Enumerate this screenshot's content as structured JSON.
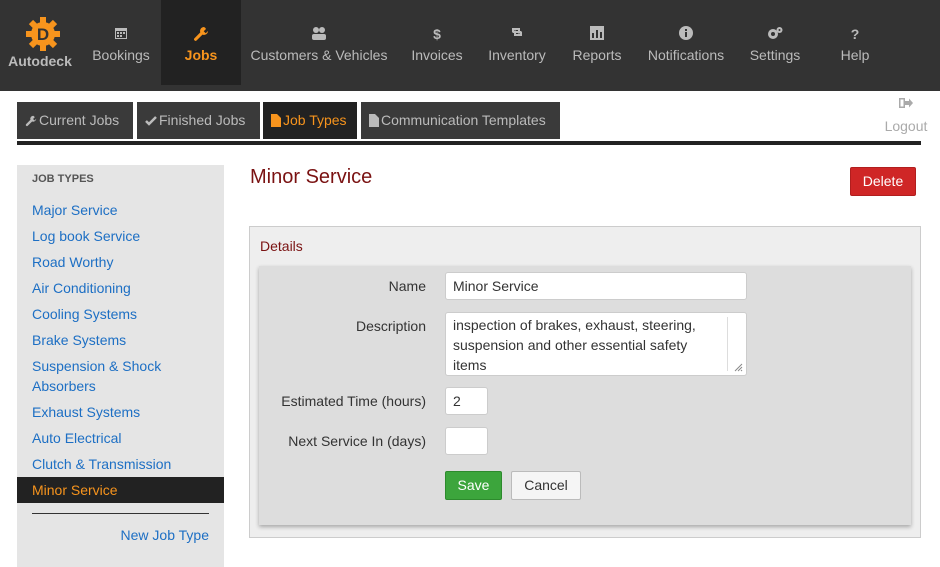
{
  "app": {
    "brand": "Autodeck"
  },
  "nav": {
    "bookings": "Bookings",
    "jobs": "Jobs",
    "customers": "Customers & Vehicles",
    "invoices": "Invoices",
    "inventory": "Inventory",
    "reports": "Reports",
    "notifications": "Notifications",
    "settings": "Settings",
    "help": "Help"
  },
  "tabs": {
    "current": "Current Jobs",
    "finished": "Finished Jobs",
    "types": "Job Types",
    "templates": "Communication Templates"
  },
  "logout": "Logout",
  "sidebar": {
    "heading": "JOB TYPES",
    "items": [
      "Major Service",
      "Log book Service",
      "Road Worthy",
      "Air Conditioning",
      "Cooling Systems",
      "Brake Systems",
      "Suspension & Shock Absorbers",
      "Exhaust Systems",
      "Auto Electrical",
      "Clutch & Transmission",
      "Minor Service"
    ],
    "new_link": "New Job Type"
  },
  "main": {
    "title": "Minor Service",
    "delete_label": "Delete",
    "panel_title": "Details",
    "form": {
      "name_label": "Name",
      "name_value": "Minor Service",
      "description_label": "Description",
      "description_value": "inspection of brakes, exhaust, steering, suspension and other essential safety items",
      "time_label": "Estimated Time (hours)",
      "time_value": "2",
      "next_label": "Next Service In (days)",
      "next_value": "",
      "save_label": "Save",
      "cancel_label": "Cancel"
    }
  },
  "colors": {
    "accent": "#f7941d",
    "link": "#1d6fc4",
    "title": "#7a1212",
    "delete": "#cf2626",
    "save": "#3ca53c"
  }
}
